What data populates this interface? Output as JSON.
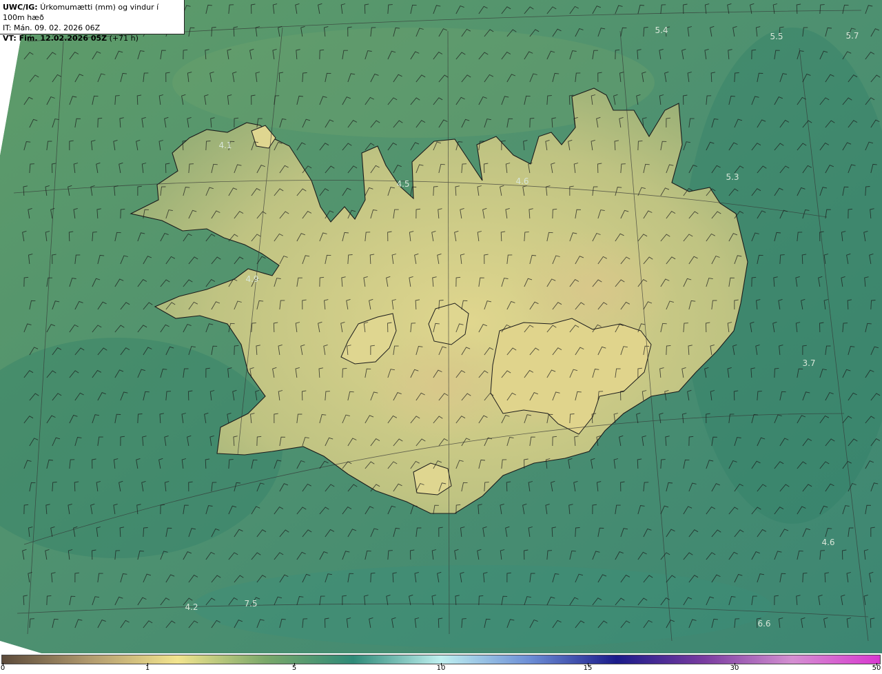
{
  "header": {
    "line1_bold": "UWC/IG:",
    "line1_text": "Úrkomumætti (mm) og vindur í 100m hæð",
    "line2": "IT: Mán. 09. 02. 2026 06Z",
    "line3_bold": "VT: Fim. 12.02.2026 05Z",
    "line3_text": "(+71 h)"
  },
  "map_labels": [
    {
      "text": "5.4",
      "pos": [
        960,
        48
      ]
    },
    {
      "text": "5.5",
      "pos": [
        1127,
        57
      ]
    },
    {
      "text": "5.7",
      "pos": [
        1237,
        56
      ]
    },
    {
      "text": "4.1",
      "pos": [
        327,
        215
      ]
    },
    {
      "text": "4.5",
      "pos": [
        585,
        271
      ]
    },
    {
      "text": "4.6",
      "pos": [
        758,
        267
      ]
    },
    {
      "text": "5.3",
      "pos": [
        1063,
        261
      ]
    },
    {
      "text": "4.9",
      "pos": [
        366,
        409
      ]
    },
    {
      "text": "3.7",
      "pos": [
        1174,
        531
      ]
    },
    {
      "text": "4.6",
      "pos": [
        1202,
        791
      ]
    },
    {
      "text": "4.2",
      "pos": [
        278,
        885
      ]
    },
    {
      "text": "7.5",
      "pos": [
        364,
        880
      ]
    },
    {
      "text": "6.6",
      "pos": [
        1109,
        909
      ]
    }
  ],
  "legend": {
    "ticks": [
      "0",
      "1",
      "5",
      "10",
      "15",
      "30",
      "50"
    ],
    "colors": [
      "#5c4a3a",
      "#b19a6e",
      "#f2e48e",
      "#7aa86a",
      "#2f8a78",
      "#bff0f0",
      "#6d8fd6",
      "#1b1b8a",
      "#7a3ca0",
      "#d48fd1",
      "#d838d0"
    ]
  },
  "colors": {
    "land": "#d6d28a",
    "sea": "#3f8a6c",
    "coastline": "#1b1b1b"
  }
}
